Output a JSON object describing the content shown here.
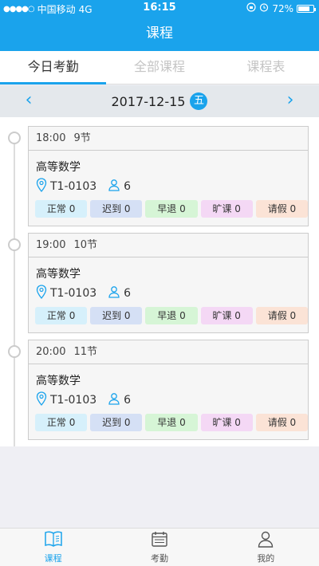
{
  "status": {
    "signal_dots": "●●●●○",
    "carrier": "中国移动",
    "network": "4G",
    "time": "16:15",
    "battery": "72%"
  },
  "header": {
    "title": "课程"
  },
  "tabs": [
    {
      "label": "今日考勤",
      "active": true
    },
    {
      "label": "全部课程",
      "active": false
    },
    {
      "label": "课程表",
      "active": false
    }
  ],
  "date_bar": {
    "date": "2017-12-15",
    "weekday": "五",
    "prev": "‹",
    "next": "›"
  },
  "courses": [
    {
      "time": "18:00",
      "period": "9节",
      "name": "高等数学",
      "room": "T1-0103",
      "students": "6",
      "stats": [
        "正常 0",
        "迟到 0",
        "早退 0",
        "旷课 0",
        "请假 0"
      ]
    },
    {
      "time": "19:00",
      "period": "10节",
      "name": "高等数学",
      "room": "T1-0103",
      "students": "6",
      "stats": [
        "正常 0",
        "迟到 0",
        "早退 0",
        "旷课 0",
        "请假 0"
      ]
    },
    {
      "time": "20:00",
      "period": "11节",
      "name": "高等数学",
      "room": "T1-0103",
      "students": "6",
      "stats": [
        "正常 0",
        "迟到 0",
        "早退 0",
        "旷课 0",
        "请假 0"
      ]
    }
  ],
  "stat_colors": [
    "#d6f0fb",
    "#d5e0f5",
    "#d6f5d6",
    "#f4d8f5",
    "#fbe3d6"
  ],
  "tabbar": [
    {
      "label": "课程",
      "icon": "book-icon",
      "active": true
    },
    {
      "label": "考勤",
      "icon": "calendar-icon",
      "active": false
    },
    {
      "label": "我的",
      "icon": "user-icon",
      "active": false
    }
  ],
  "accent": "#1aa3ec"
}
